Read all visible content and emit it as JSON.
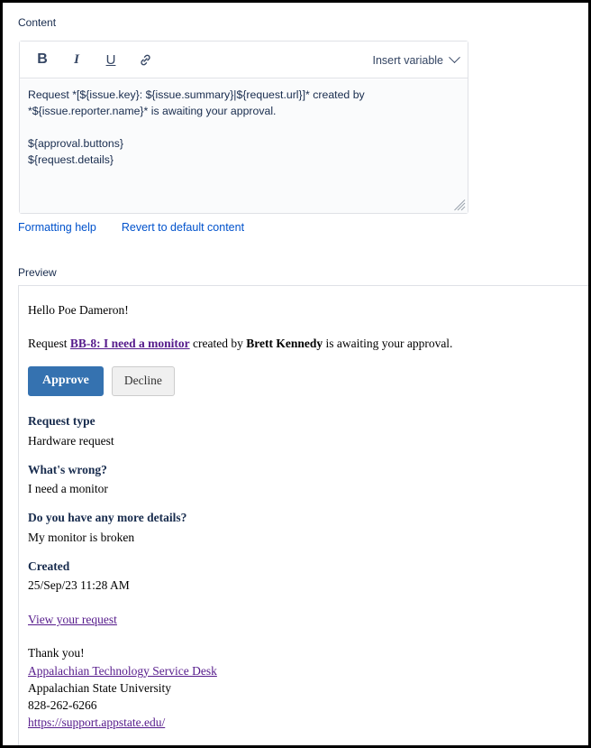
{
  "labels": {
    "content": "Content",
    "preview": "Preview"
  },
  "editor": {
    "toolbar": {
      "bold": "B",
      "italic": "I",
      "underline": "U",
      "link_icon": "link-icon",
      "insert_variable": "Insert variable"
    },
    "content_value": "Request *[${issue.key}: ${issue.summary}|${request.url}]* created by *${issue.reporter.name}* is awaiting your approval.\n\n${approval.buttons}\n${request.details}"
  },
  "actions": {
    "formatting_help": "Formatting help",
    "revert_default": "Revert to default content"
  },
  "preview": {
    "greeting": "Hello Poe Dameron!",
    "request_line": {
      "prefix": "Request ",
      "issue_link": "BB-8: I need a monitor",
      "middle": " created by ",
      "reporter": "Brett Kennedy",
      "suffix": " is awaiting your approval."
    },
    "buttons": {
      "approve": "Approve",
      "decline": "Decline"
    },
    "details": [
      {
        "label": "Request type",
        "value": "Hardware request"
      },
      {
        "label": "What's wrong?",
        "value": "I need a monitor"
      },
      {
        "label": "Do you have any more details?",
        "value": "My monitor is broken"
      },
      {
        "label": "Created",
        "value": "25/Sep/23 11:28 AM"
      }
    ],
    "view_request": "View your request",
    "signature": {
      "thanks": "Thank you!",
      "desk_link": "Appalachian Technology Service Desk",
      "organization": "Appalachian State University",
      "phone": "828-262-6266",
      "url": "https://support.appstate.edu/"
    }
  },
  "colors": {
    "link_blue": "#0052cc",
    "link_purple": "#551a8b",
    "approve_blue": "#3572b0",
    "label_navy": "#172b4d",
    "border_grey": "#dfe1e6"
  }
}
